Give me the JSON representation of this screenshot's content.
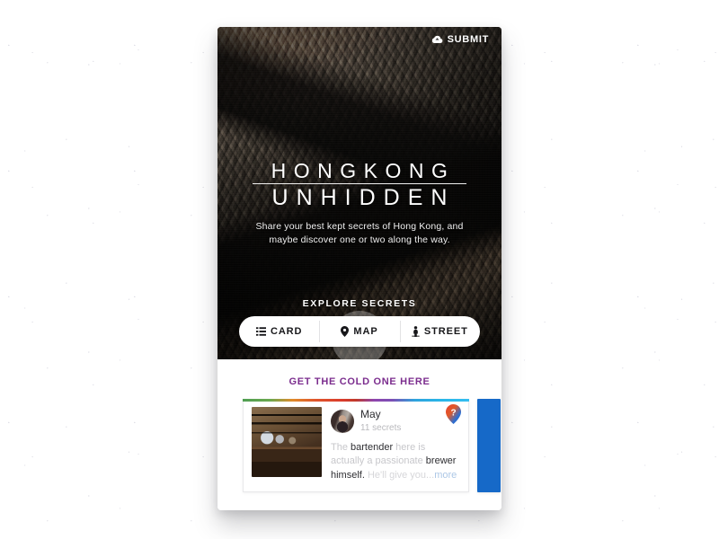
{
  "app": {
    "hero": {
      "submit_label": "SUBMIT",
      "submit_icon": "cloud-upload-icon",
      "title_line1": "HONGKONG",
      "title_line2": "UNHIDDEN",
      "subtitle": "Share your best kept secrets of Hong Kong, and maybe discover one or two along the way.",
      "explore_label": "EXPLORE SECRETS"
    },
    "segmented_control": {
      "options": [
        {
          "label": "CARD",
          "icon": "list-icon",
          "selected": false
        },
        {
          "label": "MAP",
          "icon": "map-pin-icon",
          "selected": true
        },
        {
          "label": "STREET",
          "icon": "street-view-icon",
          "selected": false
        }
      ]
    },
    "sheet": {
      "title": "GET THE COLD ONE HERE",
      "accent_color": "#7b2d8e",
      "card": {
        "thumbnail_alt": "bar-interior-photo",
        "author_name": "May",
        "author_meta": "11 secrets",
        "pin_icon": "question-pin-icon",
        "snippet_parts": [
          {
            "text": "The ",
            "style": "dim"
          },
          {
            "text": "bartender ",
            "style": "normal"
          },
          {
            "text": "here is ",
            "style": "dim"
          },
          {
            "text": "actually a passionate ",
            "style": "dim"
          },
          {
            "text": "brewer ",
            "style": "normal"
          },
          {
            "text": "himself. ",
            "style": "normal"
          },
          {
            "text": "He'll give you...",
            "style": "dim2"
          },
          {
            "text": "more",
            "style": "more"
          }
        ]
      },
      "next_card_color": "#1669c8"
    }
  }
}
